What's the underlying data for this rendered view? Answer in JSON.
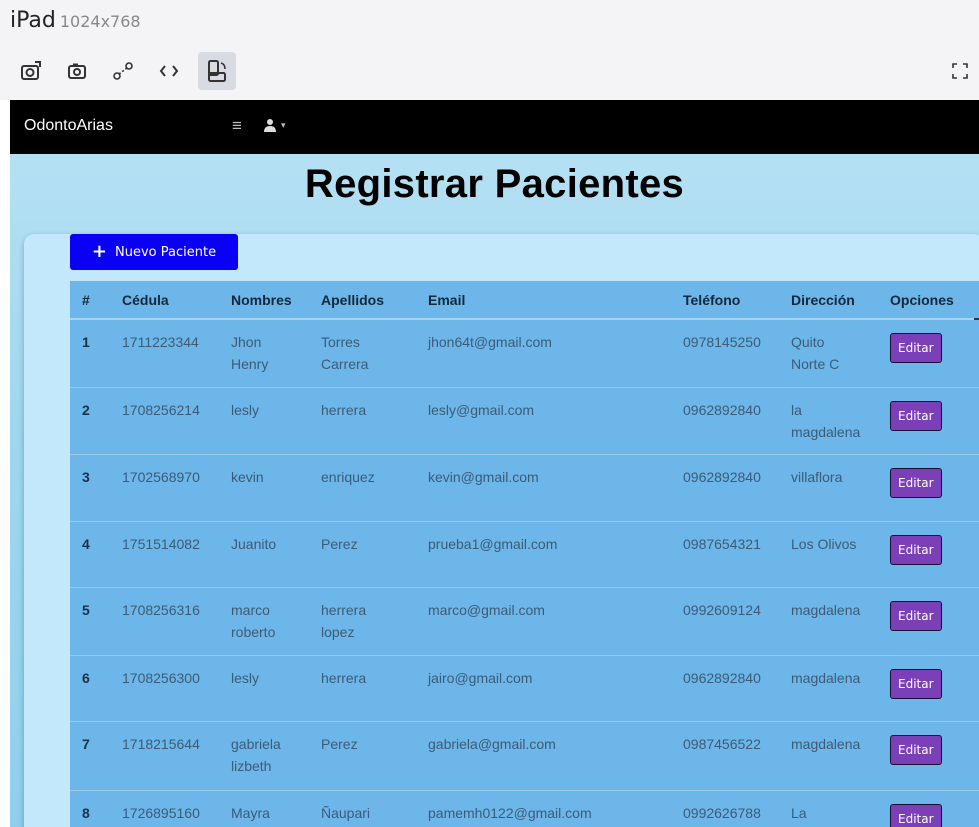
{
  "device": {
    "name": "iPad",
    "size": "1024x768"
  },
  "toolbar_icons": [
    "screenshot-icon",
    "camera-icon",
    "network-icon",
    "code-icon",
    "rotate-icon",
    "fullscreen-icon"
  ],
  "navbar": {
    "brand": "OdontoArias",
    "menu_glyph": "≡",
    "user_glyph": "👤",
    "caret": "▾"
  },
  "page": {
    "title": "Registrar Pacientes",
    "new_button": "Nuevo Paciente",
    "new_button_glyph": "+"
  },
  "table": {
    "headers": [
      "#",
      "Cédula",
      "Nombres",
      "Apellidos",
      "Email",
      "Teléfono",
      "Dirección",
      "Opciones"
    ],
    "edit_label": "Editar",
    "rows": [
      {
        "n": "1",
        "cedula": "1711223344",
        "nombres": [
          "Jhon",
          "Henry"
        ],
        "apellidos": [
          "Torres",
          "Carrera"
        ],
        "email": "jhon64t@gmail.com",
        "telefono": "0978145250",
        "direccion": [
          "Quito",
          "Norte C"
        ]
      },
      {
        "n": "2",
        "cedula": "1708256214",
        "nombres": [
          "lesly"
        ],
        "apellidos": [
          "herrera"
        ],
        "email": "lesly@gmail.com",
        "telefono": "0962892840",
        "direccion": [
          "la",
          "magdalena"
        ]
      },
      {
        "n": "3",
        "cedula": "1702568970",
        "nombres": [
          "kevin"
        ],
        "apellidos": [
          "enriquez"
        ],
        "email": "kevin@gmail.com",
        "telefono": "0962892840",
        "direccion": [
          "villaflora"
        ]
      },
      {
        "n": "4",
        "cedula": "1751514082",
        "nombres": [
          "Juanito"
        ],
        "apellidos": [
          "Perez"
        ],
        "email": "prueba1@gmail.com",
        "telefono": "0987654321",
        "direccion": [
          "Los Olivos"
        ]
      },
      {
        "n": "5",
        "cedula": "1708256316",
        "nombres": [
          "marco",
          "roberto"
        ],
        "apellidos": [
          "herrera",
          "lopez"
        ],
        "email": "marco@gmail.com",
        "telefono": "0992609124",
        "direccion": [
          "magdalena"
        ]
      },
      {
        "n": "6",
        "cedula": "1708256300",
        "nombres": [
          "lesly"
        ],
        "apellidos": [
          "herrera"
        ],
        "email": "jairo@gmail.com",
        "telefono": "0962892840",
        "direccion": [
          "magdalena"
        ]
      },
      {
        "n": "7",
        "cedula": "1718215644",
        "nombres": [
          "gabriela",
          "lizbeth"
        ],
        "apellidos": [
          "Perez"
        ],
        "email": "gabriela@gmail.com",
        "telefono": "0987456522",
        "direccion": [
          "magdalena"
        ]
      },
      {
        "n": "8",
        "cedula": "1726895160",
        "nombres": [
          "Mayra"
        ],
        "apellidos": [
          "Ñaupari"
        ],
        "email": "pamemh0122@gmail.com",
        "telefono": "0992626788",
        "direccion": [
          "La"
        ]
      }
    ]
  }
}
